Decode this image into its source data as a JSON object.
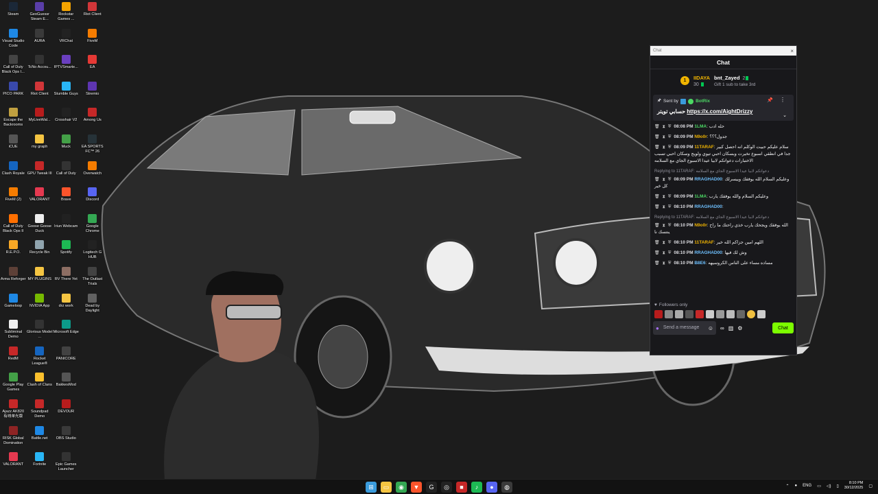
{
  "desktop": {
    "icons": [
      {
        "label": "Steam",
        "icon": "steam-icon",
        "color": "#1b2838"
      },
      {
        "label": "GeoGuessr Steam E...",
        "icon": "geoguessr-icon",
        "color": "#5a3ea8"
      },
      {
        "label": "Rockstar Games ...",
        "icon": "rockstar-icon",
        "color": "#f5a400"
      },
      {
        "label": "Riot Client",
        "icon": "riot-icon",
        "color": "#d13639"
      },
      {
        "label": "Visual Studio Code",
        "icon": "vscode-icon",
        "color": "#1e88e5"
      },
      {
        "label": "AURA",
        "icon": "aura-icon",
        "color": "#3a3a3a"
      },
      {
        "label": "VRChat",
        "icon": "vrchat-icon",
        "color": "#222222"
      },
      {
        "label": "FiveM",
        "icon": "fivem-icon",
        "color": "#f57c00"
      },
      {
        "label": "Call of Duty Black Ops I...",
        "icon": "cod-icon",
        "color": "#444444"
      },
      {
        "label": "TcNo Accou...",
        "icon": "tcno-icon",
        "color": "#333333"
      },
      {
        "label": "IPTVSmarte...",
        "icon": "iptv-icon",
        "color": "#6a3fbf"
      },
      {
        "label": "EA",
        "icon": "ea-icon",
        "color": "#e53935"
      },
      {
        "label": "PICO PARK",
        "icon": "picopark-icon",
        "color": "#3949ab"
      },
      {
        "label": "Riot Client",
        "icon": "riot-icon",
        "color": "#d13639"
      },
      {
        "label": "Stumble Guys",
        "icon": "stumble-icon",
        "color": "#29b6f6"
      },
      {
        "label": "Stremio",
        "icon": "stremio-icon",
        "color": "#5e35b1"
      },
      {
        "label": "Escape the Backrooms",
        "icon": "backrooms-icon",
        "color": "#c0a040"
      },
      {
        "label": "MyLiveWal...",
        "icon": "livewall-icon",
        "color": "#b71c1c"
      },
      {
        "label": "Crosshair V2",
        "icon": "crosshair-icon",
        "color": "#222222"
      },
      {
        "label": "Among Us",
        "icon": "amongus-icon",
        "color": "#c62828"
      },
      {
        "label": "iCUE",
        "icon": "icue-icon",
        "color": "#555555"
      },
      {
        "label": "my graph",
        "icon": "folder-icon",
        "color": "#f5c542"
      },
      {
        "label": "Muck",
        "icon": "muck-icon",
        "color": "#43a047"
      },
      {
        "label": "EA SPORTS FC™ 26",
        "icon": "easports-icon",
        "color": "#263238"
      },
      {
        "label": "Clash Royale",
        "icon": "clashroyale-icon",
        "color": "#1565c0"
      },
      {
        "label": "GPU Tweak III",
        "icon": "gputweak-icon",
        "color": "#c62828"
      },
      {
        "label": "Call of Duty",
        "icon": "cod-icon",
        "color": "#333333"
      },
      {
        "label": "Overwatch",
        "icon": "overwatch-icon",
        "color": "#f57c00"
      },
      {
        "label": "FiveM (2)",
        "icon": "fivem-icon",
        "color": "#f57c00"
      },
      {
        "label": "VALORANT",
        "icon": "valorant-icon",
        "color": "#e53950"
      },
      {
        "label": "Brave",
        "icon": "brave-icon",
        "color": "#fb542b"
      },
      {
        "label": "Discord",
        "icon": "discord-icon",
        "color": "#5865f2"
      },
      {
        "label": "Call of Duty Black Ops II",
        "icon": "cod-icon",
        "color": "#ff6f00"
      },
      {
        "label": "Goose Goose Duck",
        "icon": "goose-icon",
        "color": "#eeeeee"
      },
      {
        "label": "Iriun Webcam",
        "icon": "webcam-icon",
        "color": "#212121"
      },
      {
        "label": "Google Chrome",
        "icon": "chrome-icon",
        "color": "#34a853"
      },
      {
        "label": "R.E.P.O.",
        "icon": "repo-icon",
        "color": "#f9a825"
      },
      {
        "label": "Recycle Bin",
        "icon": "recyclebin-icon",
        "color": "#90a4ae"
      },
      {
        "label": "Spotify",
        "icon": "spotify-icon",
        "color": "#1db954"
      },
      {
        "label": "Logitech G HUB",
        "icon": "ghub-icon",
        "color": "#222222"
      },
      {
        "label": "Arma Reforger",
        "icon": "arma-icon",
        "color": "#5d4037"
      },
      {
        "label": "MY PLUGINS",
        "icon": "folder-icon",
        "color": "#f5c542"
      },
      {
        "label": "RV There Yet",
        "icon": "rv-icon",
        "color": "#8d6e63"
      },
      {
        "label": "The Outlast Trials",
        "icon": "outlast-icon",
        "color": "#424242"
      },
      {
        "label": "Gameloop",
        "icon": "gameloop-icon",
        "color": "#1e88e5"
      },
      {
        "label": "NVIDIA App",
        "icon": "nvidia-icon",
        "color": "#76b900"
      },
      {
        "label": "drz work",
        "icon": "folder-icon",
        "color": "#f5c542"
      },
      {
        "label": "Dead by Daylight",
        "icon": "dbd-icon",
        "color": "#616161"
      },
      {
        "label": "Subliminal Demo",
        "icon": "subliminal-icon",
        "color": "#eeeeee"
      },
      {
        "label": "Glorious Model ...",
        "icon": "glorious-icon",
        "color": "#333333"
      },
      {
        "label": "Microsoft Edge",
        "icon": "edge-icon",
        "color": "#0c9b8a"
      },
      {
        "label": "",
        "icon": "",
        "color": ""
      },
      {
        "label": "RedM",
        "icon": "redm-icon",
        "color": "#c62828"
      },
      {
        "label": "Rocket League®",
        "icon": "rocketleague-icon",
        "color": "#1565c0"
      },
      {
        "label": "PANICORE",
        "icon": "panicore-icon",
        "color": "#424242"
      },
      {
        "label": "",
        "icon": "",
        "color": ""
      },
      {
        "label": "Google Play Games",
        "icon": "playgames-icon",
        "color": "#43a047"
      },
      {
        "label": "Clash of Clans",
        "icon": "coc-icon",
        "color": "#fbc02d"
      },
      {
        "label": "BakkesMod",
        "icon": "bakkesmod-icon",
        "color": "#555555"
      },
      {
        "label": "",
        "icon": "",
        "color": ""
      },
      {
        "label": "Ajazz AK820 有线单光版",
        "icon": "ajazz-icon",
        "color": "#c62828"
      },
      {
        "label": "Soundpad Demo",
        "icon": "soundpad-icon",
        "color": "#c62828"
      },
      {
        "label": "DEVOUR",
        "icon": "devour-icon",
        "color": "#b71c1c"
      },
      {
        "label": "",
        "icon": "",
        "color": ""
      },
      {
        "label": "RISK Global Domination",
        "icon": "risk-icon",
        "color": "#8e2424"
      },
      {
        "label": "Battle.net",
        "icon": "battlenet-icon",
        "color": "#1e88e5"
      },
      {
        "label": "OBS Studio",
        "icon": "obs-icon",
        "color": "#3a3a3a"
      },
      {
        "label": "",
        "icon": "",
        "color": ""
      },
      {
        "label": "VALORANT",
        "icon": "valorant-icon",
        "color": "#e53950"
      },
      {
        "label": "Fortnite",
        "icon": "fortnite-icon",
        "color": "#29b6f6"
      },
      {
        "label": "Epic Games Launcher",
        "icon": "epic-icon",
        "color": "#333333"
      },
      {
        "label": "",
        "icon": "",
        "color": ""
      }
    ]
  },
  "chat": {
    "window_title": "Chat",
    "header_title": "Chat",
    "leaderboard": {
      "rank": "1",
      "top_user": "IIDAYA",
      "top_count": "30",
      "second_user": "bnt_Zayed",
      "second_count": "2",
      "gift_text": "Gift 1 sub to take 3rd"
    },
    "pinned": {
      "sent_by_label": "Sent by",
      "bot_name": "BotRix",
      "text": "حسابي تويتر",
      "link": "https://x.com/AightDrizzy"
    },
    "messages": [
      {
        "time": "08:08 PM",
        "user": "1LMA",
        "user_color": "#4cd964",
        "text": "حله ادب",
        "reply": ""
      },
      {
        "time": "08:09 PM",
        "user": "N9o0r",
        "user_color": "#f0b400",
        "text": "جدول؟؟؟",
        "reply": ""
      },
      {
        "time": "08:09 PM",
        "user": "11TARAF",
        "user_color": "#f0b400",
        "text": "سلام عليكم حبيت الوكلم انه احصل كبير جدا في انطقي اسبوع تخيرت وبسكان احبي تيوي ولويج وسكان احبي تسبب الاختبارات دعواتكم لابيا عيدا الاسبوع الجاي مع السلامه",
        "reply": ""
      },
      {
        "time": "08:09 PM",
        "user": "RRAGHAD00",
        "user_color": "#6ec0ff",
        "text": "وعليكم السلام الله يوفقك وييسرلك كل خير",
        "reply": "Replying to 11TARAF: دعواتكم لابيا عيدا الاسبوع الجاي مع السلامه"
      },
      {
        "time": "08:09 PM",
        "user": "1LMA",
        "user_color": "#4cd964",
        "text": "وعليكم السلام والله يوفقك يارب",
        "reply": ""
      },
      {
        "time": "08:10 PM",
        "user": "RRAGHAD00",
        "user_color": "#6ec0ff",
        "text": "",
        "reply": ""
      },
      {
        "time": "08:10 PM",
        "user": "N9o0r",
        "user_color": "#f0b400",
        "text": "الله يوفقك ويجحك يارب خذي راحتك ما راح ينتسك نا",
        "reply": "Replying to 11TARAF: دعواتكم لابيا عيدا الاسبوع الجاي مع السلامه"
      },
      {
        "time": "08:10 PM",
        "user": "11TARAF",
        "user_color": "#f0b400",
        "text": "اللهم امين جزاكم الله خير",
        "reply": ""
      },
      {
        "time": "08:10 PM",
        "user": "RRAGHAD00",
        "user_color": "#6ec0ff",
        "text": "وش لك فيها",
        "reply": ""
      },
      {
        "time": "08:10 PM",
        "user": "B8E6",
        "user_color": "#6ec0ff",
        "text": "مساده مساء على الناس الكروسيهه",
        "reply": ""
      }
    ],
    "followers_only": "Followers only",
    "input_placeholder": "Send a message",
    "chat_button": "Chat"
  },
  "taskbar": {
    "apps": [
      {
        "icon": "windows-start-icon",
        "glyph": "⊞",
        "color": "#3a9bdc"
      },
      {
        "icon": "file-explorer-icon",
        "glyph": "▭",
        "color": "#f5c542"
      },
      {
        "icon": "chrome-icon",
        "glyph": "◉",
        "color": "#34a853"
      },
      {
        "icon": "brave-icon",
        "glyph": "▼",
        "color": "#fb542b"
      },
      {
        "icon": "ghub-icon",
        "glyph": "G",
        "color": "#222222"
      },
      {
        "icon": "crosshair-icon",
        "glyph": "◎",
        "color": "#222222"
      },
      {
        "icon": "roblox-icon",
        "glyph": "■",
        "color": "#c62828"
      },
      {
        "icon": "spotify-icon",
        "glyph": "♪",
        "color": "#1db954"
      },
      {
        "icon": "discord-icon",
        "glyph": "●",
        "color": "#5865f2"
      },
      {
        "icon": "obs-icon",
        "glyph": "◍",
        "color": "#3a3a3a"
      }
    ],
    "lang": "ENG",
    "time": "8:10 PM",
    "date": "30/12/2025"
  }
}
